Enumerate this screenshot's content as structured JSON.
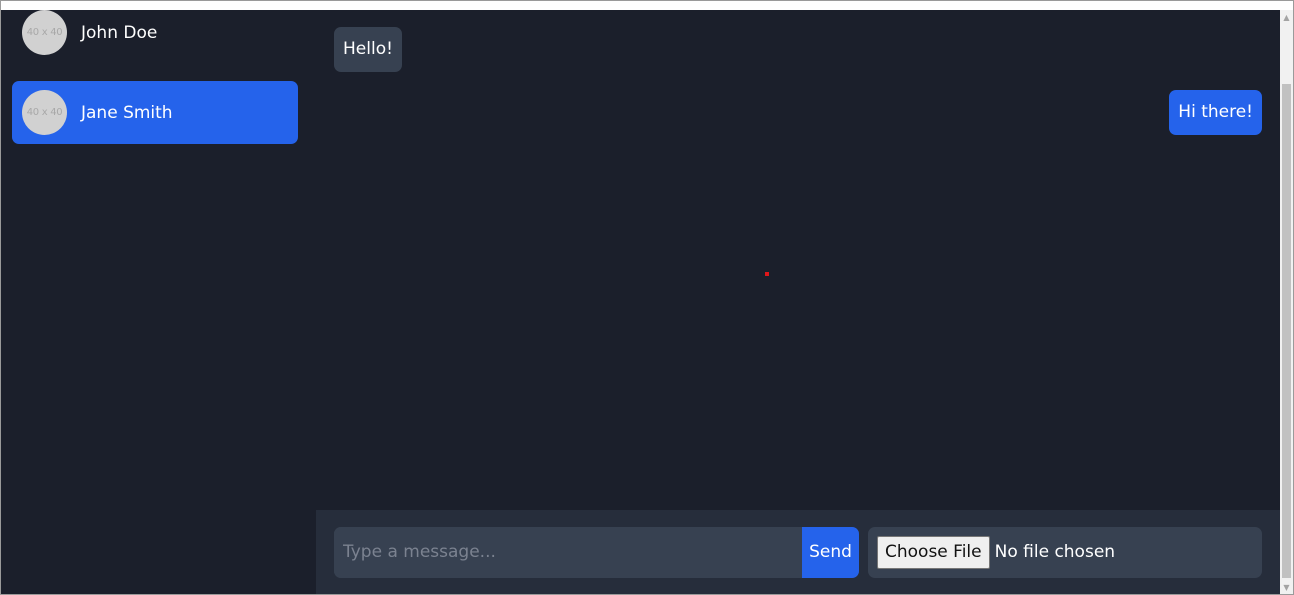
{
  "contacts": [
    {
      "name": "John Doe",
      "avatar_text": "40 x 40",
      "active": false
    },
    {
      "name": "Jane Smith",
      "avatar_text": "40 x 40",
      "active": true
    }
  ],
  "messages": [
    {
      "text": "Hello!",
      "direction": "incoming"
    },
    {
      "text": "Hi there!",
      "direction": "outgoing"
    }
  ],
  "composer": {
    "placeholder": "Type a message...",
    "value": "",
    "send_label": "Send",
    "file_button_label": "Choose File",
    "file_status": "No file chosen"
  },
  "scrollbar": {
    "up_icon": "▲",
    "down_icon": "▼"
  },
  "colors": {
    "background": "#1b1f2b",
    "accent": "#2563eb",
    "incoming_bubble": "#374151",
    "composer_bg": "#262d3b"
  }
}
